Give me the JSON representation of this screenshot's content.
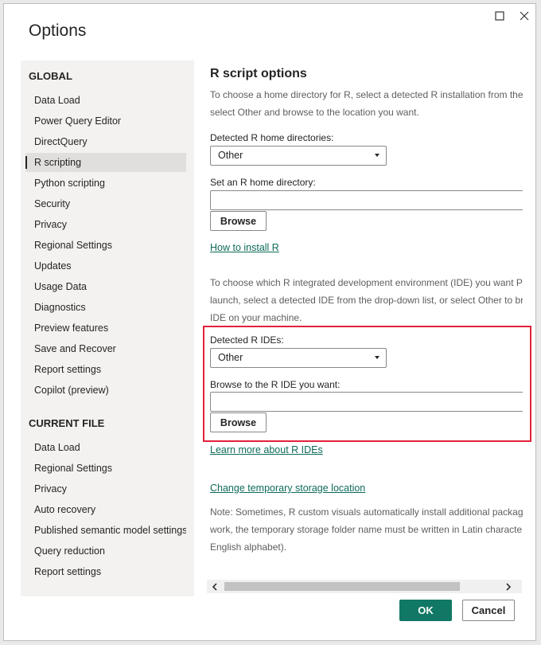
{
  "dialog": {
    "title": "Options"
  },
  "sidebar": {
    "global_heading": "GLOBAL",
    "global_items": [
      {
        "label": "Data Load"
      },
      {
        "label": "Power Query Editor"
      },
      {
        "label": "DirectQuery"
      },
      {
        "label": "R scripting",
        "active": true
      },
      {
        "label": "Python scripting"
      },
      {
        "label": "Security"
      },
      {
        "label": "Privacy"
      },
      {
        "label": "Regional Settings"
      },
      {
        "label": "Updates"
      },
      {
        "label": "Usage Data"
      },
      {
        "label": "Diagnostics"
      },
      {
        "label": "Preview features"
      },
      {
        "label": "Save and Recover"
      },
      {
        "label": "Report settings"
      },
      {
        "label": "Copilot (preview)"
      }
    ],
    "current_heading": "CURRENT FILE",
    "current_items": [
      {
        "label": "Data Load"
      },
      {
        "label": "Regional Settings"
      },
      {
        "label": "Privacy"
      },
      {
        "label": "Auto recovery"
      },
      {
        "label": "Published semantic model settings"
      },
      {
        "label": "Query reduction"
      },
      {
        "label": "Report settings"
      }
    ]
  },
  "content": {
    "heading": "R script options",
    "intro_line1": "To choose a home directory for R, select a detected R installation from the",
    "intro_line2": "select Other and browse to the location you want.",
    "detected_home_label": "Detected R home directories:",
    "detected_home_value": "Other",
    "set_home_label": "Set an R home directory:",
    "set_home_value": "",
    "browse_label_1": "Browse",
    "install_link": "How to install R",
    "ide_line1": "To choose which R integrated development environment (IDE) you want Po",
    "ide_line2": "launch, select a detected IDE from the drop-down list, or select Other to br",
    "ide_line3": "IDE on your machine.",
    "detected_ide_label": "Detected R IDEs:",
    "detected_ide_value": "Other",
    "browse_ide_label": "Browse to the R IDE you want:",
    "browse_ide_value": "",
    "browse_label_2": "Browse",
    "learn_link": "Learn more about R IDEs",
    "storage_link": "Change temporary storage location",
    "note_line1": "Note: Sometimes, R custom visuals automatically install additional package",
    "note_line2": "work, the temporary storage folder name must be written in Latin characte",
    "note_line3": "English alphabet)."
  },
  "footer": {
    "ok_label": "OK",
    "cancel_label": "Cancel"
  },
  "colors": {
    "accent": "#117865",
    "link": "#0e6b5a",
    "highlight": "#e3213a"
  }
}
